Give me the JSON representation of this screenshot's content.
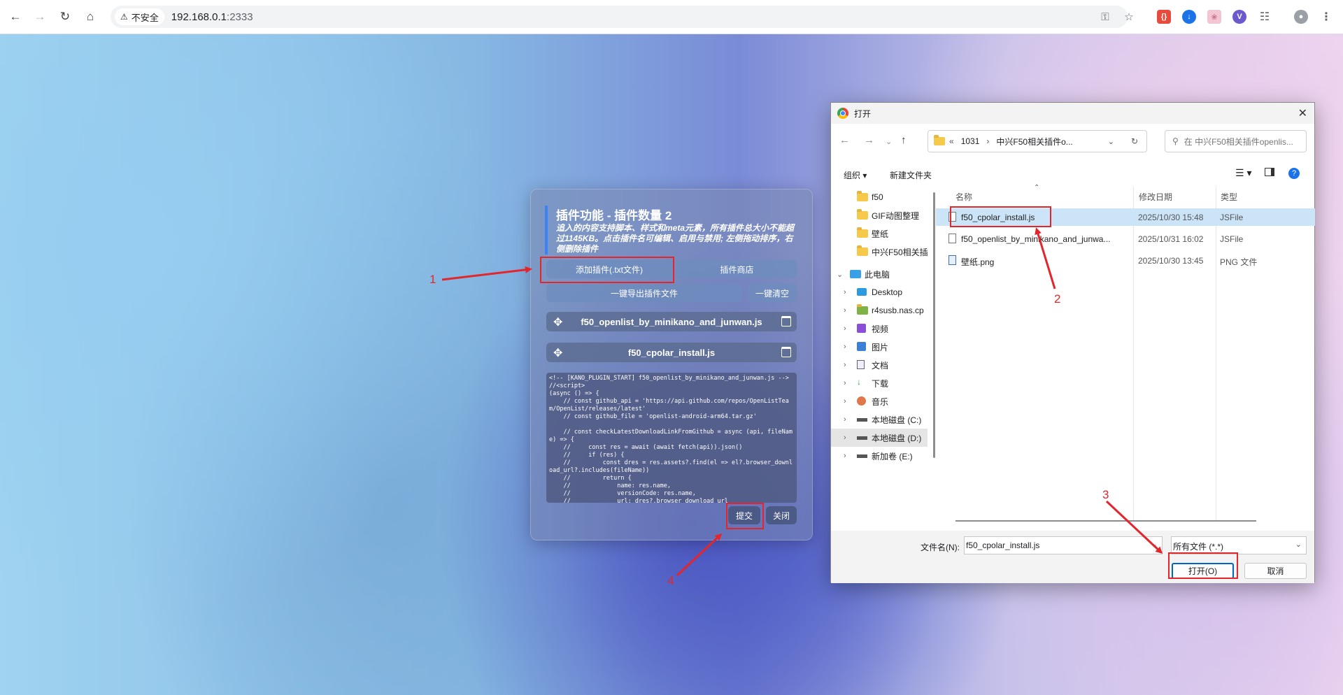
{
  "browser": {
    "security_label": "不安全",
    "url_host": "192.168.0.1",
    "url_port": ":2333"
  },
  "panel": {
    "title": "插件功能 - 插件数量 2",
    "description": "追入的内容支持脚本、样式和meta元素，所有插件总大小不能超过1145KB。点击插件名可编辑、启用与禁用; 左侧拖动排序，右侧删除插件",
    "add_plugin_label": "添加插件(.txt文件)",
    "plugin_store_label": "插件商店",
    "export_label": "一键导出插件文件",
    "clear_label": "一键清空",
    "plugins": [
      {
        "name": "f50_openlist_by_minikano_and_junwan.js"
      },
      {
        "name": "f50_cpolar_install.js"
      }
    ],
    "code": "<!-- [KANO_PLUGIN_START] f50_openlist_by_minikano_and_junwan.js -->\n//<script>\n(async () => {\n    // const github_api = 'https://api.github.com/repos/OpenListTeam/OpenList/releases/latest'\n    // const github_file = 'openlist-android-arm64.tar.gz'\n\n    // const checkLatestDownloadLinkFromGithub = async (api, fileName) => {\n    //     const res = await (await fetch(api)).json()\n    //     if (res) {\n    //         const dres = res.assets?.find(el => el?.browser_download_url?.includes(fileName))\n    //         return {\n    //             name: res.name,\n    //             versionCode: res.name,\n    //             url: dres?.browser_download_url",
    "submit_label": "提交",
    "close_label": "关闭"
  },
  "dialog": {
    "title": "打开",
    "breadcrumb": [
      "«",
      "1031",
      "›",
      "中兴F50相关插件o..."
    ],
    "search_placeholder": "在 中兴F50相关插件openlis...",
    "organize_label": "组织 ▾",
    "new_folder_label": "新建文件夹",
    "columns": {
      "name": "名称",
      "date": "修改日期",
      "type": "类型"
    },
    "tree": [
      {
        "label": "f50",
        "icon": "folder"
      },
      {
        "label": "GIF动图整理",
        "icon": "folder"
      },
      {
        "label": "壁纸",
        "icon": "folder"
      },
      {
        "label": "中兴F50相关插",
        "icon": "folder"
      },
      {
        "label": "此电脑",
        "icon": "pc"
      },
      {
        "label": "Desktop",
        "icon": "desktop"
      },
      {
        "label": "r4susb.nas.cp",
        "icon": "folder"
      },
      {
        "label": "视频",
        "icon": "video"
      },
      {
        "label": "图片",
        "icon": "picture"
      },
      {
        "label": "文档",
        "icon": "document"
      },
      {
        "label": "下载",
        "icon": "download"
      },
      {
        "label": "音乐",
        "icon": "music"
      },
      {
        "label": "本地磁盘 (C:)",
        "icon": "drive"
      },
      {
        "label": "本地磁盘 (D:)",
        "icon": "drive"
      },
      {
        "label": "新加卷 (E:)",
        "icon": "drive"
      }
    ],
    "files": [
      {
        "name": "f50_cpolar_install.js",
        "date": "2025/10/30 15:48",
        "type": "JSFile",
        "icon": "file"
      },
      {
        "name": "f50_openlist_by_minikano_and_junwa...",
        "date": "2025/10/31 16:02",
        "type": "JSFile",
        "icon": "file"
      },
      {
        "name": "壁纸.png",
        "date": "2025/10/30 13:45",
        "type": "PNG 文件",
        "icon": "image-file"
      }
    ],
    "filename_label": "文件名(N):",
    "filename_value": "f50_cpolar_install.js",
    "filetype_value": "所有文件 (*.*)",
    "open_label": "打开(O)",
    "cancel_label": "取消"
  },
  "annotations": {
    "n1": "1",
    "n2": "2",
    "n3": "3",
    "n4": "4"
  },
  "colors": {
    "annotation": "#e3262c",
    "accent": "#3b82f6"
  }
}
